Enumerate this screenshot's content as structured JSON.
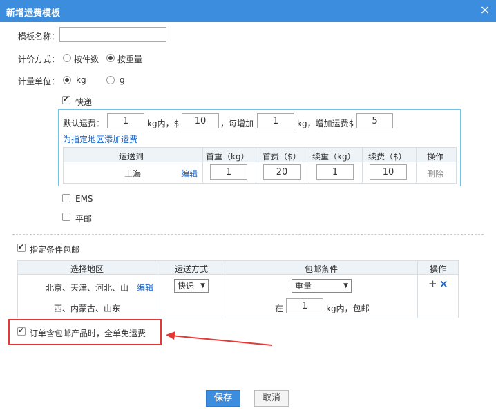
{
  "dialog": {
    "title": "新增运费模板",
    "close_glyph": "×"
  },
  "form": {
    "name_label": "模板名称：",
    "name_value": "",
    "pricing_label": "计价方式：",
    "pricing_options": [
      "按件数",
      "按重量"
    ],
    "unit_label": "计量单位：",
    "unit_options": [
      "kg",
      "g"
    ]
  },
  "express": {
    "label": "快递",
    "default_prefix": "默认运费：",
    "first_weight": "1",
    "within_text": "kg内，$",
    "first_fee": "10",
    "per_add_text": "，每增加",
    "add_weight": "1",
    "add_fee_text": "kg，增加运费$",
    "add_fee": "5",
    "add_region_link": "为指定地区添加运费",
    "table": {
      "headers": [
        "运送到",
        "首重（kg）",
        "首费（$）",
        "续重（kg）",
        "续费（$）",
        "操作"
      ],
      "row": {
        "region": "上海",
        "edit": "编辑",
        "first_weight": "1",
        "first_fee": "20",
        "add_weight": "1",
        "add_fee": "10",
        "delete": "删除"
      }
    }
  },
  "ems_label": "EMS",
  "post_label": "平邮",
  "free_shipping": {
    "label": "指定条件包邮",
    "headers": [
      "选择地区",
      "运送方式",
      "包邮条件",
      "操作"
    ],
    "row": {
      "regions_line1": "北京、天津、河北、山",
      "edit": "编辑",
      "regions_line2": "西、内蒙古、山东",
      "method": "快递",
      "condition": "重量",
      "in_text": "在",
      "weight": "1",
      "suffix": "kg内，包邮",
      "add_glyph": "+",
      "remove_glyph": "×"
    }
  },
  "order_free": {
    "label": "订单含包邮产品时，全单免运费"
  },
  "buttons": {
    "save": "保存",
    "cancel": "取消"
  },
  "colors": {
    "titlebar": "#3c8dde",
    "highlight_red": "#e53935",
    "link": "#1a66c8"
  }
}
